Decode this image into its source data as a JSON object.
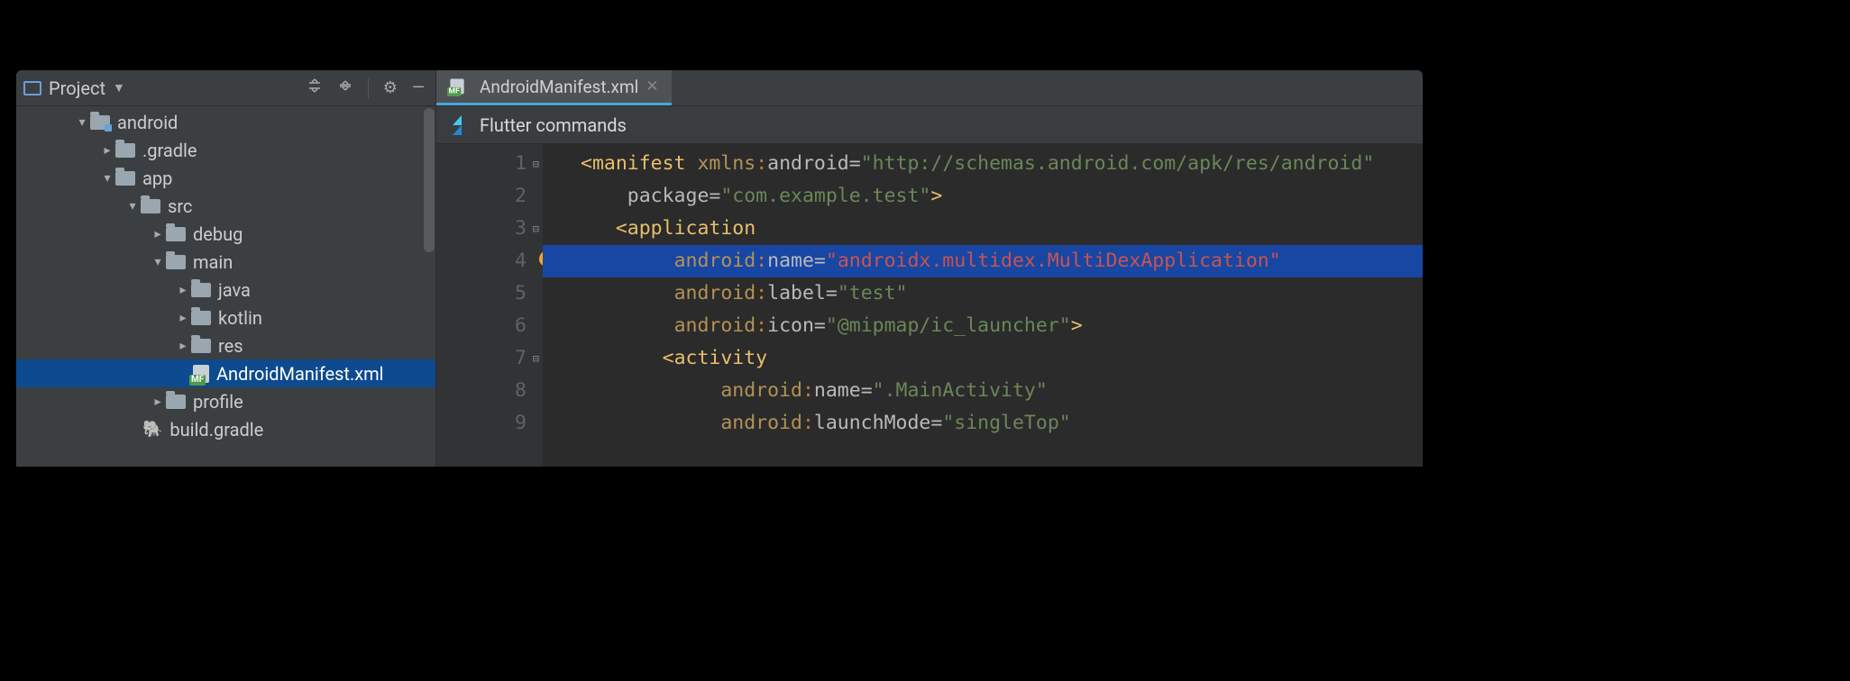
{
  "project_panel": {
    "title": "Project",
    "tree": [
      {
        "indent": 64,
        "chev": "down",
        "icon": "folder-module",
        "label": "android"
      },
      {
        "indent": 92,
        "chev": "right",
        "icon": "folder",
        "label": ".gradle"
      },
      {
        "indent": 92,
        "chev": "down",
        "icon": "folder",
        "label": "app"
      },
      {
        "indent": 120,
        "chev": "down",
        "icon": "folder",
        "label": "src"
      },
      {
        "indent": 148,
        "chev": "right",
        "icon": "folder",
        "label": "debug"
      },
      {
        "indent": 148,
        "chev": "down",
        "icon": "folder",
        "label": "main"
      },
      {
        "indent": 176,
        "chev": "right",
        "icon": "folder",
        "label": "java"
      },
      {
        "indent": 176,
        "chev": "right",
        "icon": "folder",
        "label": "kotlin"
      },
      {
        "indent": 176,
        "chev": "right",
        "icon": "folder",
        "label": "res"
      },
      {
        "indent": 176,
        "chev": "none",
        "icon": "file-mf",
        "label": "AndroidManifest.xml",
        "selected": true
      },
      {
        "indent": 148,
        "chev": "right",
        "icon": "folder",
        "label": "profile"
      },
      {
        "indent": 120,
        "chev": "none",
        "icon": "elephant",
        "label": "build.gradle"
      }
    ]
  },
  "tabs": {
    "active": {
      "label": "AndroidManifest.xml"
    }
  },
  "banner": {
    "text": "Flutter commands"
  },
  "editor": {
    "gutter_lines": [
      "1",
      "2",
      "3",
      "4",
      "5",
      "6",
      "7",
      "8",
      "9"
    ],
    "highlighted_line_index": 3,
    "code": {
      "l1": {
        "pre": "<",
        "tag": "manifest ",
        "ns": "xmlns",
        "colon": ":",
        "attr": "android",
        "eq": "=",
        "q1": "\"",
        "val": "http://schemas.android.com/apk/res/android",
        "q2": "\""
      },
      "l2": {
        "indent": "    ",
        "attr": "package",
        "eq": "=",
        "q1": "\"",
        "val": "com.example.test",
        "q2": "\"",
        "close": ">"
      },
      "l3": {
        "indent": "   ",
        "pre": "<",
        "tag": "application"
      },
      "l4": {
        "indent": "        ",
        "ns": "android",
        "colon": ":",
        "attr": "name",
        "eq": "=",
        "q1": "\"",
        "val": "androidx.multidex.MultiDexApplication",
        "q2": "\""
      },
      "l5": {
        "indent": "        ",
        "ns": "android",
        "colon": ":",
        "attr": "label",
        "eq": "=",
        "q1": "\"",
        "val": "test",
        "q2": "\""
      },
      "l6": {
        "indent": "        ",
        "ns": "android",
        "colon": ":",
        "attr": "icon",
        "eq": "=",
        "q1": "\"",
        "val": "@mipmap/ic_launcher",
        "q2": "\"",
        "close": ">"
      },
      "l7": {
        "indent": "       ",
        "pre": "<",
        "tag": "activity"
      },
      "l8": {
        "indent": "            ",
        "ns": "android",
        "colon": ":",
        "attr": "name",
        "eq": "=",
        "q1": "\"",
        "val": ".MainActivity",
        "q2": "\""
      },
      "l9": {
        "indent": "            ",
        "ns": "android",
        "colon": ":",
        "attr": "launchMode",
        "eq": "=",
        "q1": "\"",
        "val": "singleTop",
        "q2": "\""
      }
    }
  }
}
